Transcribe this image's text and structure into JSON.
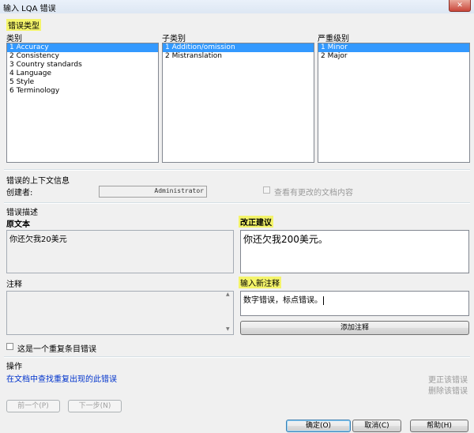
{
  "window": {
    "title": "输入 LQA 错误",
    "close_glyph": "✕"
  },
  "error_type": {
    "heading": "错误类型",
    "category": {
      "label": "类别",
      "items": [
        "1 Accuracy",
        "2 Consistency",
        "3 Country standards",
        "4 Language",
        "5 Style",
        "6 Terminology"
      ],
      "selected": 0
    },
    "subcategory": {
      "label": "子类别",
      "items": [
        "1 Addition/omission",
        "2 Mistranslation"
      ],
      "selected": 0
    },
    "severity": {
      "label": "严重级别",
      "items": [
        "1 Minor",
        "2 Major"
      ],
      "selected": 0
    }
  },
  "context": {
    "heading": "错误的上下文信息",
    "creator_label": "创建者:",
    "creator_value": "Administrator",
    "view_changed_label": "查看有更改的文档内容"
  },
  "description": {
    "heading": "错误描述",
    "source_label": "原文本",
    "source_text": "你还欠我20美元",
    "suggestion_label": "改正建议",
    "suggestion_text": "你还欠我200美元。",
    "comments_label": "注释",
    "new_comment_label": "输入新注释",
    "new_comment_text": "数字错误，标点错误。",
    "add_comment_button": "添加注释",
    "repeat_label": "这是一个重复条目错误"
  },
  "operations": {
    "heading": "操作",
    "find_link": "在文档中查找重复出现的此错误",
    "change_error": "更正该错误",
    "delete_error": "删除该错误",
    "prev_button": "前一个(P)",
    "next_button": "下一步(N)"
  },
  "footer": {
    "ok_button": "确定(O)",
    "cancel_button": "取消(C)",
    "help_button": "帮助(H)"
  }
}
